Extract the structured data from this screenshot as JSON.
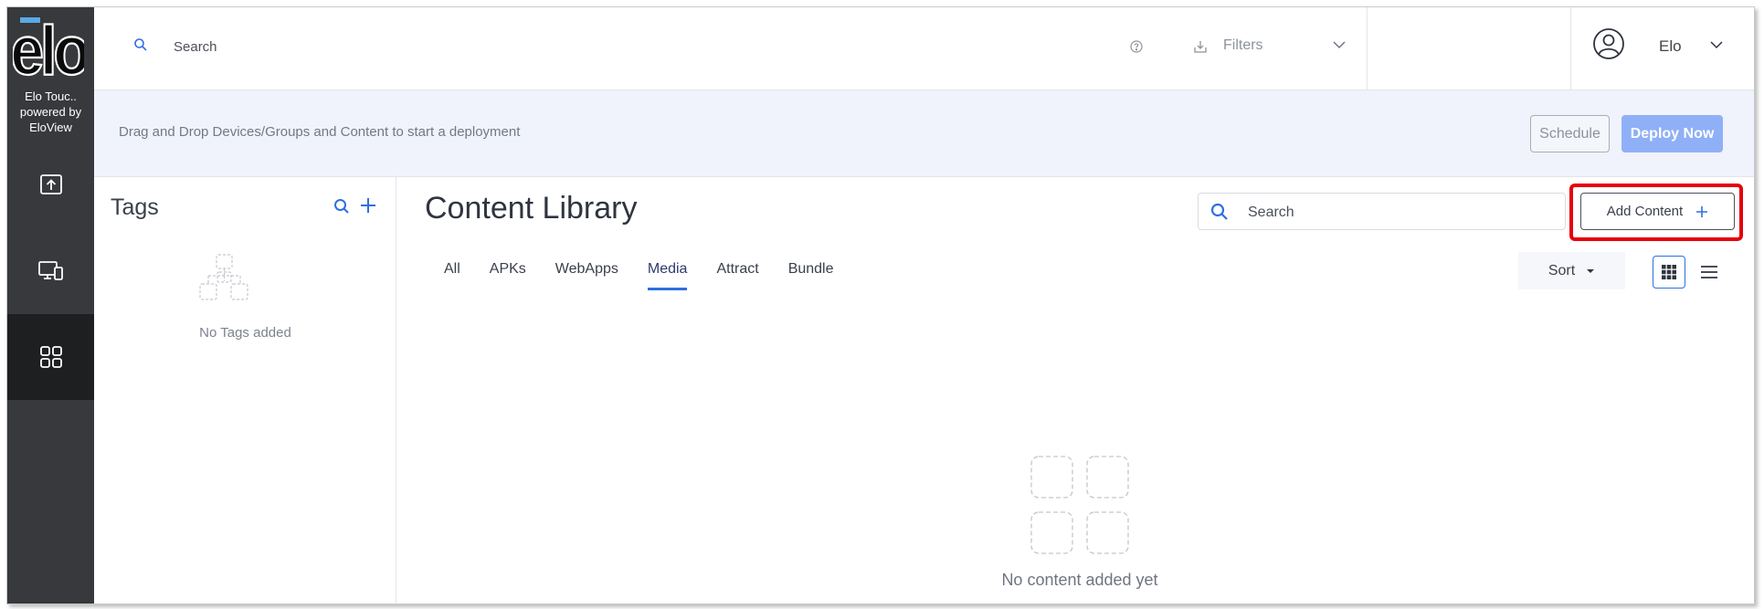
{
  "sidebar": {
    "logo_text": "elo",
    "brand_lines": [
      "Elo Touc..",
      "powered by",
      "EloView"
    ],
    "items": [
      {
        "name": "deploy",
        "icon": "upload-icon",
        "active": false
      },
      {
        "name": "devices",
        "icon": "devices-icon",
        "active": false
      },
      {
        "name": "content",
        "icon": "grid-apps-icon",
        "active": true
      }
    ]
  },
  "topbar": {
    "search_placeholder": "Search",
    "filters_label": "Filters",
    "user_name": "Elo"
  },
  "banner": {
    "message": "Drag and Drop Devices/Groups and Content to start a deployment",
    "schedule_label": "Schedule",
    "deploy_label": "Deploy Now"
  },
  "tags": {
    "title": "Tags",
    "empty_text": "No Tags added"
  },
  "content": {
    "title": "Content Library",
    "search_placeholder": "Search",
    "add_label": "Add Content",
    "tabs": [
      "All",
      "APKs",
      "WebApps",
      "Media",
      "Attract",
      "Bundle"
    ],
    "active_tab": "Media",
    "sort_label": "Sort",
    "empty_text": "No content added yet"
  },
  "colors": {
    "sidebar_bg": "#37393c",
    "sidebar_active": "#1e1f21",
    "accent_blue": "#2e6fe0",
    "deploy_button": "#8fb0f6",
    "banner_bg": "#f0f3fc",
    "highlight_red": "#e5000b"
  }
}
